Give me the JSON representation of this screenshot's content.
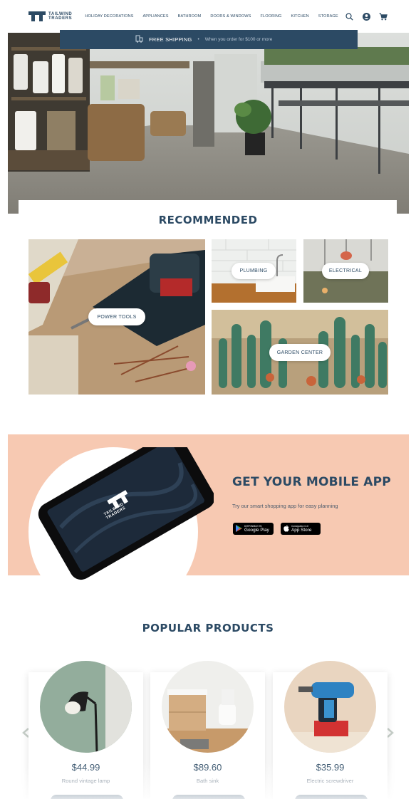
{
  "brand": {
    "line1": "TAILWIND",
    "line2": "TRADERS"
  },
  "nav": {
    "items": [
      {
        "label": "HOLIDAY DECORATIONS"
      },
      {
        "label": "APPLIANCES"
      },
      {
        "label": "BATHROOM"
      },
      {
        "label": "DOORS & WINDOWS"
      },
      {
        "label": "FLOORING"
      },
      {
        "label": "KITCHEN"
      },
      {
        "label": "STORAGE"
      }
    ],
    "icons": [
      "search-icon",
      "user-icon",
      "cart-icon"
    ]
  },
  "shipping": {
    "title": "FREE SHIPPING",
    "separator": "•",
    "subtitle": "When you order for $100 or more",
    "icon": "truck-icon"
  },
  "recommended": {
    "title": "RECOMMENDED",
    "tiles": [
      {
        "label": "POWER TOOLS"
      },
      {
        "label": "PLUMBING"
      },
      {
        "label": "ELECTRICAL"
      },
      {
        "label": "GARDEN CENTER"
      }
    ]
  },
  "app": {
    "title": "GET YOUR MOBILE APP",
    "subtitle": "Try our smart shopping app for easy planning",
    "phone_brand_line1": "TAILWIND",
    "phone_brand_line2": "TRADERS",
    "google": {
      "small": "DISPONIBLE EN",
      "big": "Google Play"
    },
    "apple": {
      "small": "Consíguelo en el",
      "big": "App Store"
    }
  },
  "popular": {
    "title": "POPULAR PRODUCTS",
    "products": [
      {
        "price": "$44.99",
        "name": "Round vintage lamp"
      },
      {
        "price": "$89.60",
        "name": "Bath sink"
      },
      {
        "price": "$35.99",
        "name": "Electric screwdriver"
      }
    ]
  },
  "colors": {
    "navy": "#2c4a64",
    "peach": "#f7c9b2"
  }
}
